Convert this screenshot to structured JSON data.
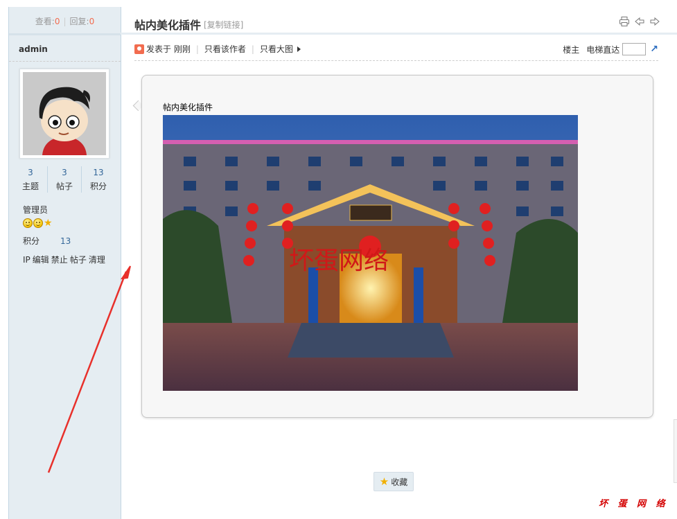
{
  "sidebar": {
    "view_label": "查看:",
    "view_count": "0",
    "reply_label": "回复:",
    "reply_count": "0",
    "username": "admin",
    "stats": [
      {
        "value": "3",
        "label": "主题"
      },
      {
        "value": "3",
        "label": "帖子"
      },
      {
        "value": "13",
        "label": "积分"
      }
    ],
    "group": "管理员",
    "credit_label": "积分",
    "credit_value": "13",
    "admin_tools": [
      "IP",
      "编辑",
      "禁止",
      "帖子",
      "清理"
    ]
  },
  "thread": {
    "title": "帖内美化插件",
    "copy_link": "[复制链接]",
    "icons": [
      "print-icon",
      "prev-thread-icon",
      "next-thread-icon"
    ]
  },
  "post_info": {
    "posted": "发表于 刚刚",
    "only_author": "只看该作者",
    "only_large_image": "只看大图",
    "floor_label": "楼主",
    "elevator_label": "电梯直达"
  },
  "post": {
    "text": "帖内美化插件",
    "image_watermark": "坏蛋网络"
  },
  "favorite_label": "收藏",
  "corner_watermark": "坏 蛋 网 络",
  "colors": {
    "accent_red": "#f26c4f",
    "sidebar_bg": "#e5edf2",
    "link_blue": "#336699",
    "arrow_red": "#e8302b"
  }
}
